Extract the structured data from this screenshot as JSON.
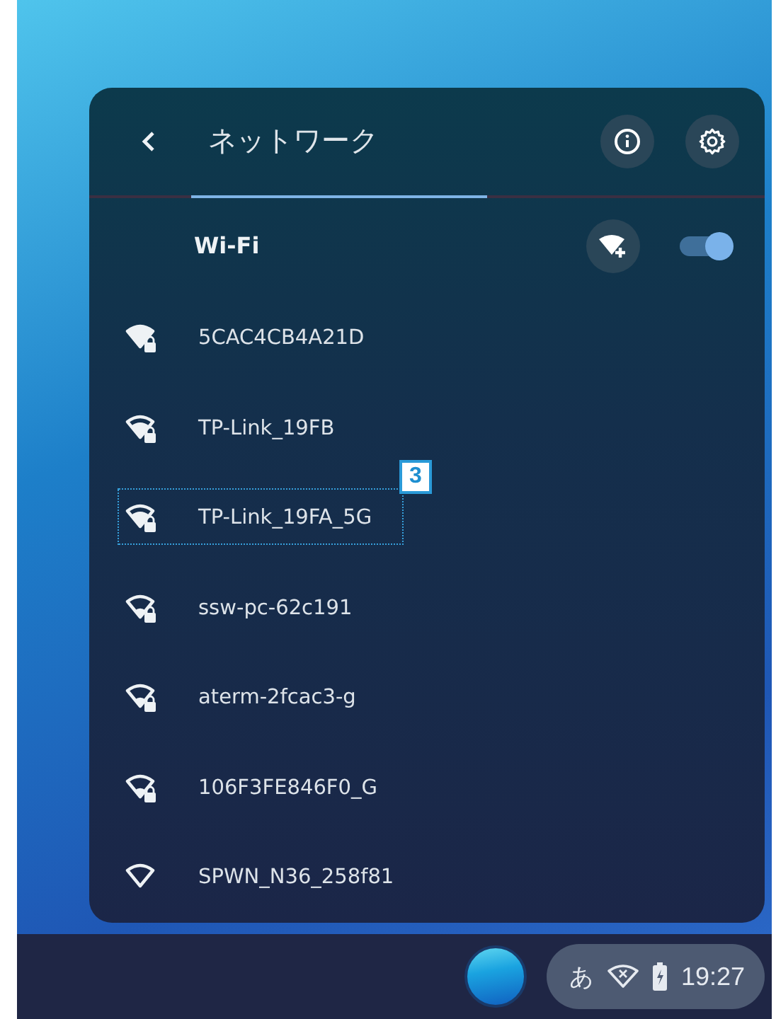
{
  "panel": {
    "title": "ネットワーク",
    "scan": {
      "level": 0.59
    },
    "wifi": {
      "label": "Wi-Fi",
      "on": true
    }
  },
  "networks": [
    {
      "name": "5CAC4CB4A21D",
      "kind": "full",
      "secured": true
    },
    {
      "name": "TP-Link_19FB",
      "kind": "high",
      "secured": true
    },
    {
      "name": "TP-Link_19FA_5G",
      "kind": "high",
      "secured": true,
      "callout": "3"
    },
    {
      "name": "ssw-pc-62c191",
      "kind": "low",
      "secured": true
    },
    {
      "name": "aterm-2fcac3-g",
      "kind": "low",
      "secured": true
    },
    {
      "name": "106F3FE846F0_G",
      "kind": "low",
      "secured": true
    },
    {
      "name": "SPWN_N36_258f81",
      "kind": "none",
      "secured": false
    }
  ],
  "tray": {
    "ime": "あ",
    "time": "19:27"
  }
}
